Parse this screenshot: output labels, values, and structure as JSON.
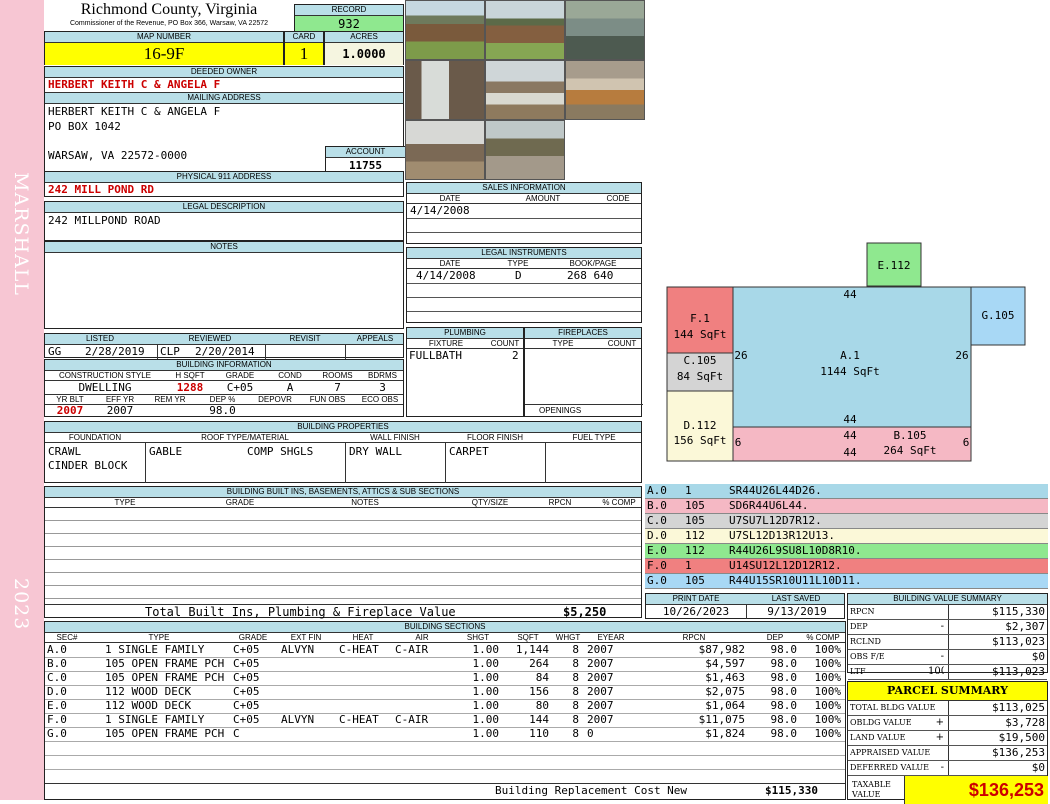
{
  "sideband": {
    "district": "MARSHALL",
    "year": "2023"
  },
  "header": {
    "county": "Richmond County, Virginia",
    "commissioner": "Commissioner of the Revenue, PO Box 366, Warsaw, VA 22572",
    "record_label": "RECORD",
    "record": "932",
    "map_label": "MAP NUMBER",
    "map_number": "16-9F",
    "card_label": "CARD",
    "card": "1",
    "acres_label": "ACRES",
    "acres": "1.0000"
  },
  "owner": {
    "deeded_label": "DEEDED OWNER",
    "deeded": "HERBERT KEITH C & ANGELA F",
    "mailing_label": "MAILING ADDRESS",
    "mail1": "HERBERT KEITH C & ANGELA F",
    "mail2": "PO BOX 1042",
    "mail3": "WARSAW, VA 22572-0000",
    "account_label": "ACCOUNT",
    "account": "11755"
  },
  "address": {
    "label": "PHYSICAL 911 ADDRESS",
    "value": "242 MILL POND RD"
  },
  "legal": {
    "label": "LEGAL DESCRIPTION",
    "value": "242 MILLPOND ROAD"
  },
  "notes": {
    "label": "NOTES"
  },
  "sales": {
    "label": "SALES INFORMATION",
    "h_date": "DATE",
    "h_amount": "AMOUNT",
    "h_code": "CODE",
    "date": "4/14/2008"
  },
  "instruments": {
    "label": "LEGAL INSTRUMENTS",
    "h_date": "DATE",
    "h_type": "TYPE",
    "h_bp": "BOOK/PAGE",
    "date": "4/14/2008",
    "type": "D",
    "bp": "268 640"
  },
  "listed": {
    "h_listed": "LISTED",
    "h_reviewed": "REVIEWED",
    "h_revisit": "REVISIT",
    "h_appeals": "APPEALS",
    "l1": "GG",
    "l2": "2/28/2019",
    "r1": "CLP",
    "r2": "2/20/2014"
  },
  "plumbing": {
    "label": "PLUMBING",
    "h_fixture": "FIXTURE",
    "h_count": "COUNT",
    "fixture": "FULLBATH",
    "count": "2"
  },
  "fireplaces": {
    "label": "FIREPLACES",
    "h_type": "TYPE",
    "h_count": "COUNT",
    "openings": "OPENINGS"
  },
  "building": {
    "label": "BUILDING INFORMATION",
    "h_style": "CONSTRUCTION STYLE",
    "h_hsqft": "H SQFT",
    "h_grade": "GRADE",
    "h_cond": "COND",
    "h_rooms": "ROOMS",
    "h_bdrms": "BDRMS",
    "style": "DWELLING",
    "hsqft": "1288",
    "grade": "C+05",
    "cond": "A",
    "rooms": "7",
    "bdrms": "3",
    "h_yrblt": "YR BLT",
    "h_effyr": "EFF YR",
    "h_remyr": "REM YR",
    "h_dep": "DEP %",
    "h_depovr": "DEPOVR",
    "h_funobs": "FUN OBS",
    "h_ecoobs": "ECO OBS",
    "yrblt": "2007",
    "effyr": "2007",
    "dep": "98.0"
  },
  "properties": {
    "label": "BUILDING PROPERTIES",
    "h_found": "FOUNDATION",
    "h_roof": "ROOF TYPE/MATERIAL",
    "h_wall": "WALL FINISH",
    "h_floor": "FLOOR FINISH",
    "h_fuel": "FUEL TYPE",
    "found1": "CRAWL",
    "found2": "CINDER BLOCK",
    "roof1": "GABLE",
    "roof2": "COMP SHGLS",
    "wall": "DRY WALL",
    "floor": "CARPET"
  },
  "builtins": {
    "label": "BUILDING BUILT INS, BASEMENTS, ATTICS & SUB SECTIONS",
    "h_type": "TYPE",
    "h_grade": "GRADE",
    "h_notes": "NOTES",
    "h_qty": "QTY/SIZE",
    "h_rpcn": "RPCN",
    "h_comp": "% COMP",
    "total_label": "Total Built Ins, Plumbing & Fireplace Value",
    "total": "$5,250"
  },
  "sketch": {
    "E": "E.112",
    "F1": "F.1",
    "F1s": "144 SqFt",
    "C": "C.105",
    "Cs": "84 SqFt",
    "D": "D.112",
    "Ds": "156 SqFt",
    "A": "A.1",
    "As": "1144 SqFt",
    "B": "B.105",
    "Bs": "264 SqFt",
    "G": "G.105",
    "d44": "44",
    "d26": "26",
    "d6": "6"
  },
  "vectors": [
    {
      "sec": "A.0",
      "code": "1",
      "vec": "SR44U26L44D26.",
      "color": "#a8d8e8"
    },
    {
      "sec": "B.0",
      "code": "105",
      "vec": "SD6R44U6L44.",
      "color": "#f5b8c4"
    },
    {
      "sec": "C.0",
      "code": "105",
      "vec": "U7SU7L12D7R12.",
      "color": "#d4d4d4"
    },
    {
      "sec": "D.0",
      "code": "112",
      "vec": "U7SL12D13R12U13.",
      "color": "#fbf8d8"
    },
    {
      "sec": "E.0",
      "code": "112",
      "vec": "R44U26L9SU8L10D8R10.",
      "color": "#8fe88f"
    },
    {
      "sec": "F.0",
      "code": "1",
      "vec": "U14SU12L12D12R12.",
      "color": "#f08080"
    },
    {
      "sec": "G.0",
      "code": "105",
      "vec": "R44U15SR10U11L10D11.",
      "color": "#a8d8f5"
    }
  ],
  "print": {
    "h_print": "PRINT DATE",
    "h_saved": "LAST SAVED",
    "print": "10/26/2023",
    "saved": "9/13/2019"
  },
  "bvs": {
    "label": "BUILDING VALUE SUMMARY",
    "rows": [
      {
        "k": "RPCN",
        "s": "",
        "v": "$115,330"
      },
      {
        "k": "DEP",
        "s": "-",
        "v": "$2,307"
      },
      {
        "k": "RCLND",
        "s": "",
        "v": "$113,023"
      },
      {
        "k": "OBS F/E",
        "s": "-",
        "v": "$0"
      },
      {
        "k": "LTF",
        "s": "100%",
        "v": "$113,023"
      }
    ]
  },
  "parcel": {
    "label": "PARCEL SUMMARY",
    "rows": [
      {
        "k": "TOTAL BLDG VALUE",
        "s": "",
        "v": "$113,025"
      },
      {
        "k": "OBLDG VALUE",
        "s": "+",
        "v": "$3,728"
      },
      {
        "k": "LAND VALUE",
        "s": "+",
        "v": "$19,500"
      },
      {
        "k": "APPRAISED VALUE",
        "s": "",
        "v": "$136,253"
      },
      {
        "k": "DEFERRED VALUE",
        "s": "-",
        "v": "$0"
      }
    ],
    "taxable_label1": "TAXABLE",
    "taxable_label2": "VALUE",
    "taxable": "$136,253"
  },
  "sections": {
    "label": "BUILDING SECTIONS",
    "headers": [
      "SEC#",
      "TYPE",
      "GRADE",
      "EXT FIN",
      "HEAT",
      "AIR",
      "SHGT",
      "SQFT",
      "WHGT",
      "EYEAR",
      "RPCN",
      "DEP",
      "% COMP"
    ],
    "rows": [
      [
        "A.0",
        "1 SINGLE FAMILY",
        "C+05",
        "ALVYN",
        "C-HEAT",
        "C-AIR",
        "1.00",
        "1,144",
        "8",
        "2007",
        "$87,982",
        "98.0",
        "100%"
      ],
      [
        "B.0",
        "105 OPEN FRAME PCH",
        "C+05",
        "",
        "",
        "",
        "1.00",
        "264",
        "8",
        "2007",
        "$4,597",
        "98.0",
        "100%"
      ],
      [
        "C.0",
        "105 OPEN FRAME PCH",
        "C+05",
        "",
        "",
        "",
        "1.00",
        "84",
        "8",
        "2007",
        "$1,463",
        "98.0",
        "100%"
      ],
      [
        "D.0",
        "112 WOOD DECK",
        "C+05",
        "",
        "",
        "",
        "1.00",
        "156",
        "8",
        "2007",
        "$2,075",
        "98.0",
        "100%"
      ],
      [
        "E.0",
        "112 WOOD DECK",
        "C+05",
        "",
        "",
        "",
        "1.00",
        "80",
        "8",
        "2007",
        "$1,064",
        "98.0",
        "100%"
      ],
      [
        "F.0",
        "1 SINGLE FAMILY",
        "C+05",
        "ALVYN",
        "C-HEAT",
        "C-AIR",
        "1.00",
        "144",
        "8",
        "2007",
        "$11,075",
        "98.0",
        "100%"
      ],
      [
        "G.0",
        "105 OPEN FRAME PCH",
        "C",
        "",
        "",
        "",
        "1.00",
        "110",
        "8",
        "0",
        "$1,824",
        "98.0",
        "100%"
      ]
    ],
    "brcn_label": "Building Replacement Cost New",
    "brcn": "$115,330"
  }
}
